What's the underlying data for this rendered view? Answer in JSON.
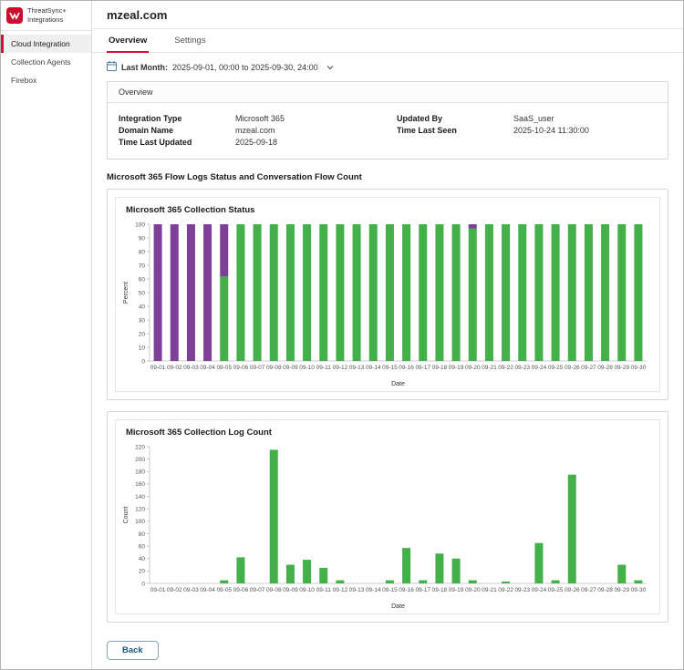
{
  "sidebar": {
    "logo_title": "ThreatSync+",
    "logo_subtitle": "Integrations",
    "items": [
      {
        "label": "Cloud Integration",
        "active": true
      },
      {
        "label": "Collection Agents",
        "active": false
      },
      {
        "label": "Firebox",
        "active": false
      }
    ]
  },
  "header": {
    "title": "mzeal.com"
  },
  "tabs": [
    {
      "label": "Overview",
      "active": true
    },
    {
      "label": "Settings",
      "active": false
    }
  ],
  "date_filter": {
    "label": "Last Month:",
    "value": "2025-09-01, 00:00 to 2025-09-30, 24:00"
  },
  "overview_card": {
    "title": "Overview",
    "fields_left": [
      {
        "label": "Integration Type",
        "value": "Microsoft 365"
      },
      {
        "label": "Domain Name",
        "value": "mzeal.com"
      },
      {
        "label": "Time Last Updated",
        "value": "2025-09-18"
      }
    ],
    "fields_right": [
      {
        "label": "Updated By",
        "value": "SaaS_user"
      },
      {
        "label": "Time Last Seen",
        "value": "2025-10-24 11:30:00"
      }
    ]
  },
  "section_title": "Microsoft 365 Flow Logs Status and Conversation Flow Count",
  "back_button": "Back",
  "colors": {
    "green": "#43b04a",
    "purple": "#7d3f98",
    "red": "#d0103a"
  },
  "chart_data": [
    {
      "type": "bar",
      "stacked": true,
      "title": "Microsoft 365 Collection Status",
      "xlabel": "Date",
      "ylabel": "Percent",
      "ylim": [
        0,
        100
      ],
      "ytick_step": 10,
      "grid": false,
      "legend": "none",
      "categories": [
        "09-01",
        "09-02",
        "09-03",
        "09-04",
        "09-05",
        "09-06",
        "09-07",
        "09-08",
        "09-09",
        "09-10",
        "09-11",
        "09-12",
        "09-13",
        "09-14",
        "09-15",
        "09-16",
        "09-17",
        "09-18",
        "09-19",
        "09-20",
        "09-21",
        "09-22",
        "09-23",
        "09-24",
        "09-25",
        "09-26",
        "09-27",
        "09-28",
        "09-29",
        "09-30"
      ],
      "series": [
        {
          "name": "collected",
          "color": "#43b04a",
          "values": [
            0,
            0,
            0,
            0,
            62,
            100,
            100,
            100,
            100,
            100,
            100,
            100,
            100,
            100,
            100,
            100,
            100,
            100,
            100,
            97,
            100,
            100,
            100,
            100,
            100,
            100,
            100,
            100,
            100,
            100
          ]
        },
        {
          "name": "not-collected",
          "color": "#7d3f98",
          "values": [
            100,
            100,
            100,
            100,
            38,
            0,
            0,
            0,
            0,
            0,
            0,
            0,
            0,
            0,
            0,
            0,
            0,
            0,
            0,
            3,
            0,
            0,
            0,
            0,
            0,
            0,
            0,
            0,
            0,
            0
          ]
        }
      ]
    },
    {
      "type": "bar",
      "stacked": false,
      "title": "Microsoft 365 Collection Log Count",
      "xlabel": "Date",
      "ylabel": "Count",
      "ylim": [
        0,
        220
      ],
      "ytick_step": 20,
      "grid": false,
      "legend": "none",
      "categories": [
        "09-01",
        "09-02",
        "09-03",
        "09-04",
        "09-05",
        "09-06",
        "09-07",
        "09-08",
        "09-09",
        "09-10",
        "09-11",
        "09-12",
        "09-13",
        "09-14",
        "09-15",
        "09-16",
        "09-17",
        "09-18",
        "09-19",
        "09-20",
        "09-21",
        "09-22",
        "09-23",
        "09-24",
        "09-25",
        "09-26",
        "09-27",
        "09-28",
        "09-29",
        "09-30"
      ],
      "series": [
        {
          "name": "log-count",
          "color": "#43b04a",
          "values": [
            0,
            0,
            0,
            0,
            5,
            42,
            0,
            215,
            30,
            38,
            25,
            5,
            0,
            0,
            5,
            57,
            5,
            48,
            40,
            5,
            0,
            3,
            0,
            65,
            5,
            175,
            0,
            0,
            30,
            5
          ]
        }
      ]
    }
  ]
}
